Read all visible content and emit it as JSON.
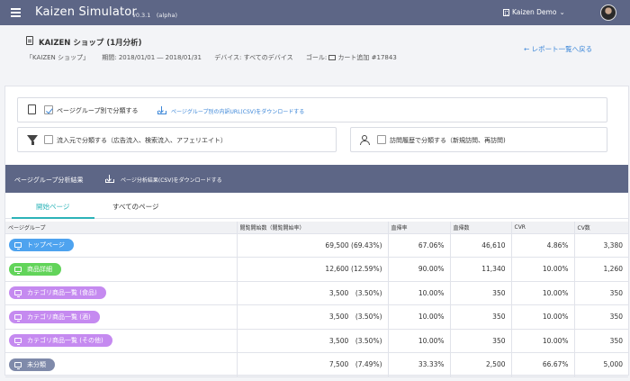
{
  "app": {
    "title": "Kaizen Simulator",
    "version": "v0.3.1　(alpha)",
    "account": "Kaizen Demo"
  },
  "report": {
    "title": "KAIZEN ショップ (1月分析)",
    "site": "「KAIZEN ショップ」",
    "period": "期間: 2018/01/01 ― 2018/01/31",
    "device": "デバイス: すべてのデバイス",
    "goal_label": "ゴール:",
    "goal_value": "カート追加 #17843",
    "back_label": "← レポート一覧へ戻る"
  },
  "options": {
    "page_group_label": "ページグループ別で分類する",
    "page_group_checked": true,
    "page_group_download": "ページグループ別の内訳URL(CSV)をダウンロードする",
    "source_label": "流入元で分類する（広告流入、検索流入、アフェリエイト）",
    "source_checked": false,
    "history_label": "訪問履歴で分類する（新規訪問、再訪問)",
    "history_checked": false
  },
  "results": {
    "title": "ページグループ分析結果",
    "download": "ページ分析結果(CSV)をダウンロードする"
  },
  "tabs": [
    {
      "label": "開始ページ",
      "active": true
    },
    {
      "label": "すべてのページ",
      "active": false
    }
  ],
  "table": {
    "columns": [
      "ページグループ",
      "閲覧開始数（閲覧開始率）",
      "直帰率",
      "直帰数",
      "CVR",
      "CV数"
    ],
    "rows": [
      {
        "group": "トップページ",
        "color": "#4ea3ef",
        "starts": "69,500 (69.43%)",
        "bounce_rate": "67.06%",
        "bounces": "46,610",
        "cvr": "4.86%",
        "cv": "3,380"
      },
      {
        "group": "商品詳細",
        "color": "#62d45a",
        "starts": "12,600 (12.59%)",
        "bounce_rate": "90.00%",
        "bounces": "11,340",
        "cvr": "10.00%",
        "cv": "1,260"
      },
      {
        "group": "カテゴリ商品一覧 (食品)",
        "color": "#c58af0",
        "starts": "3,500　(3.50%)",
        "bounce_rate": "10.00%",
        "bounces": "350",
        "cvr": "10.00%",
        "cv": "350"
      },
      {
        "group": "カテゴリ商品一覧 (酒)",
        "color": "#c58af0",
        "starts": "3,500　(3.50%)",
        "bounce_rate": "10.00%",
        "bounces": "350",
        "cvr": "10.00%",
        "cv": "350"
      },
      {
        "group": "カテゴリ商品一覧 (その他)",
        "color": "#c58af0",
        "starts": "3,500　(3.50%)",
        "bounce_rate": "10.00%",
        "bounces": "350",
        "cvr": "10.00%",
        "cv": "350"
      },
      {
        "group": "未分類",
        "color": "#7f8aaa",
        "starts": "7,500　(7.49%)",
        "bounce_rate": "33.33%",
        "bounces": "2,500",
        "cvr": "66.67%",
        "cv": "5,000"
      }
    ]
  }
}
